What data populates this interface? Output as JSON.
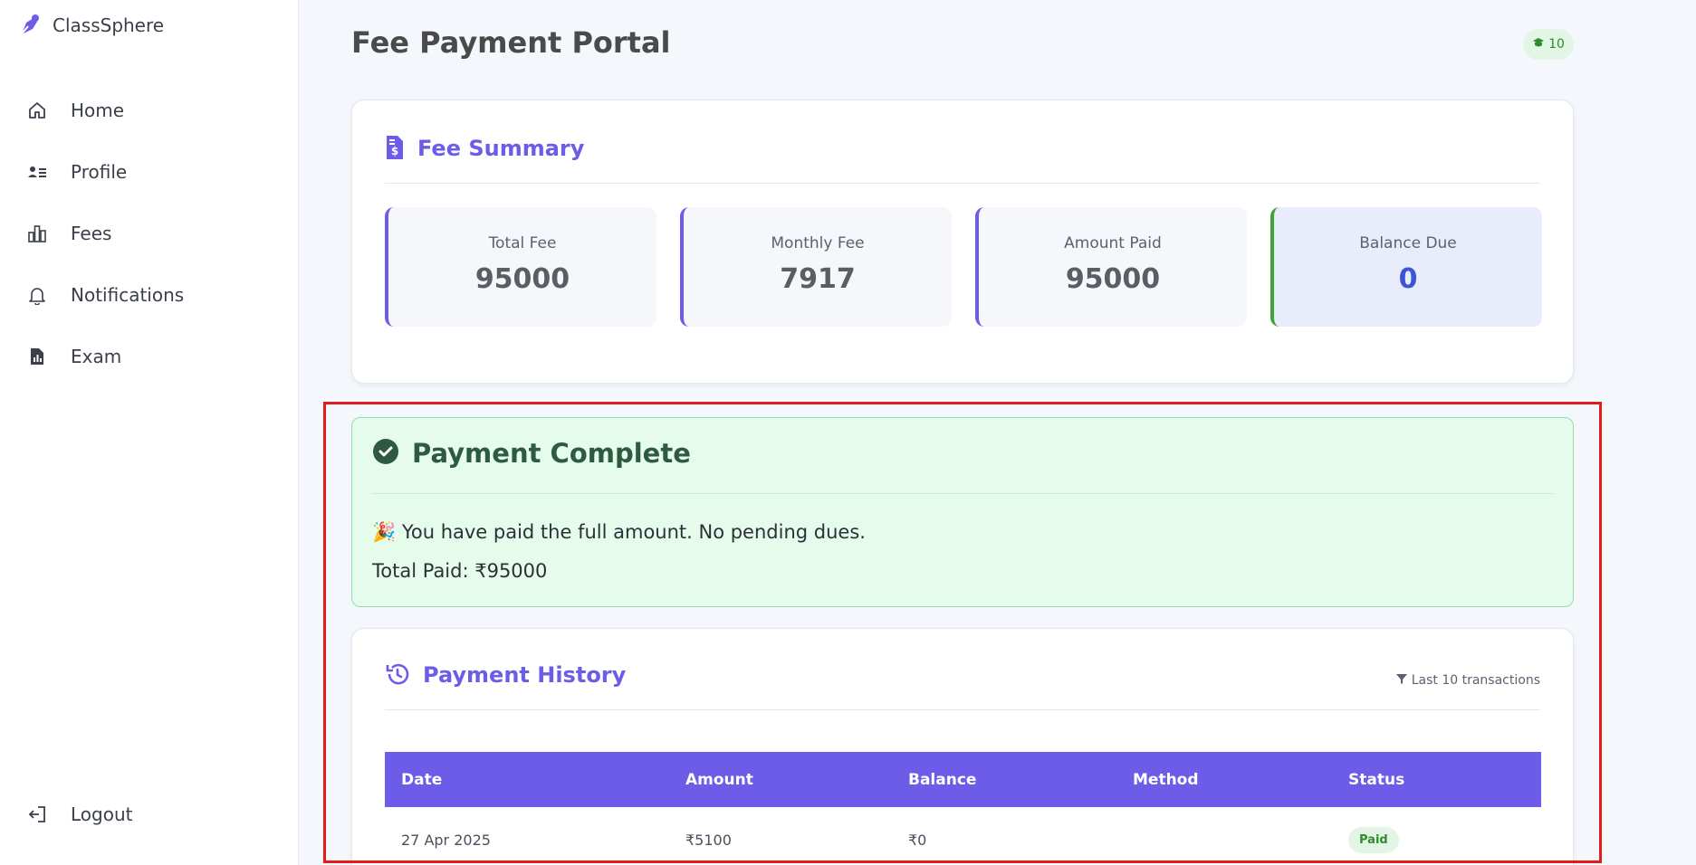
{
  "app": {
    "name": "ClassSphere"
  },
  "sidebar": {
    "items": [
      {
        "label": "Home",
        "icon": "home-icon"
      },
      {
        "label": "Profile",
        "icon": "profile-card-icon"
      },
      {
        "label": "Fees",
        "icon": "chart-bars-icon"
      },
      {
        "label": "Notifications",
        "icon": "bell-icon"
      },
      {
        "label": "Exam",
        "icon": "document-chart-icon"
      }
    ],
    "logout_label": "Logout"
  },
  "header": {
    "title": "Fee Payment Portal",
    "badge_count": "10"
  },
  "summary": {
    "title": "Fee Summary",
    "stats": [
      {
        "label": "Total Fee",
        "value": "95000"
      },
      {
        "label": "Monthly Fee",
        "value": "7917"
      },
      {
        "label": "Amount Paid",
        "value": "95000"
      },
      {
        "label": "Balance Due",
        "value": "0"
      }
    ]
  },
  "complete": {
    "title": "Payment Complete",
    "message": "🎉 You have paid the full amount. No pending dues.",
    "total_paid": "Total Paid: ₹95000"
  },
  "history": {
    "title": "Payment History",
    "filter_note": "Last 10 transactions",
    "columns": [
      "Date",
      "Amount",
      "Balance",
      "Method",
      "Status"
    ],
    "rows": [
      {
        "date": "27 Apr 2025",
        "amount": "₹5100",
        "balance": "₹0",
        "method": "",
        "status": "Paid"
      }
    ]
  },
  "colors": {
    "accent": "#6c5ce7",
    "success_bg": "#e5fbec",
    "highlight": "#e21b1b"
  }
}
